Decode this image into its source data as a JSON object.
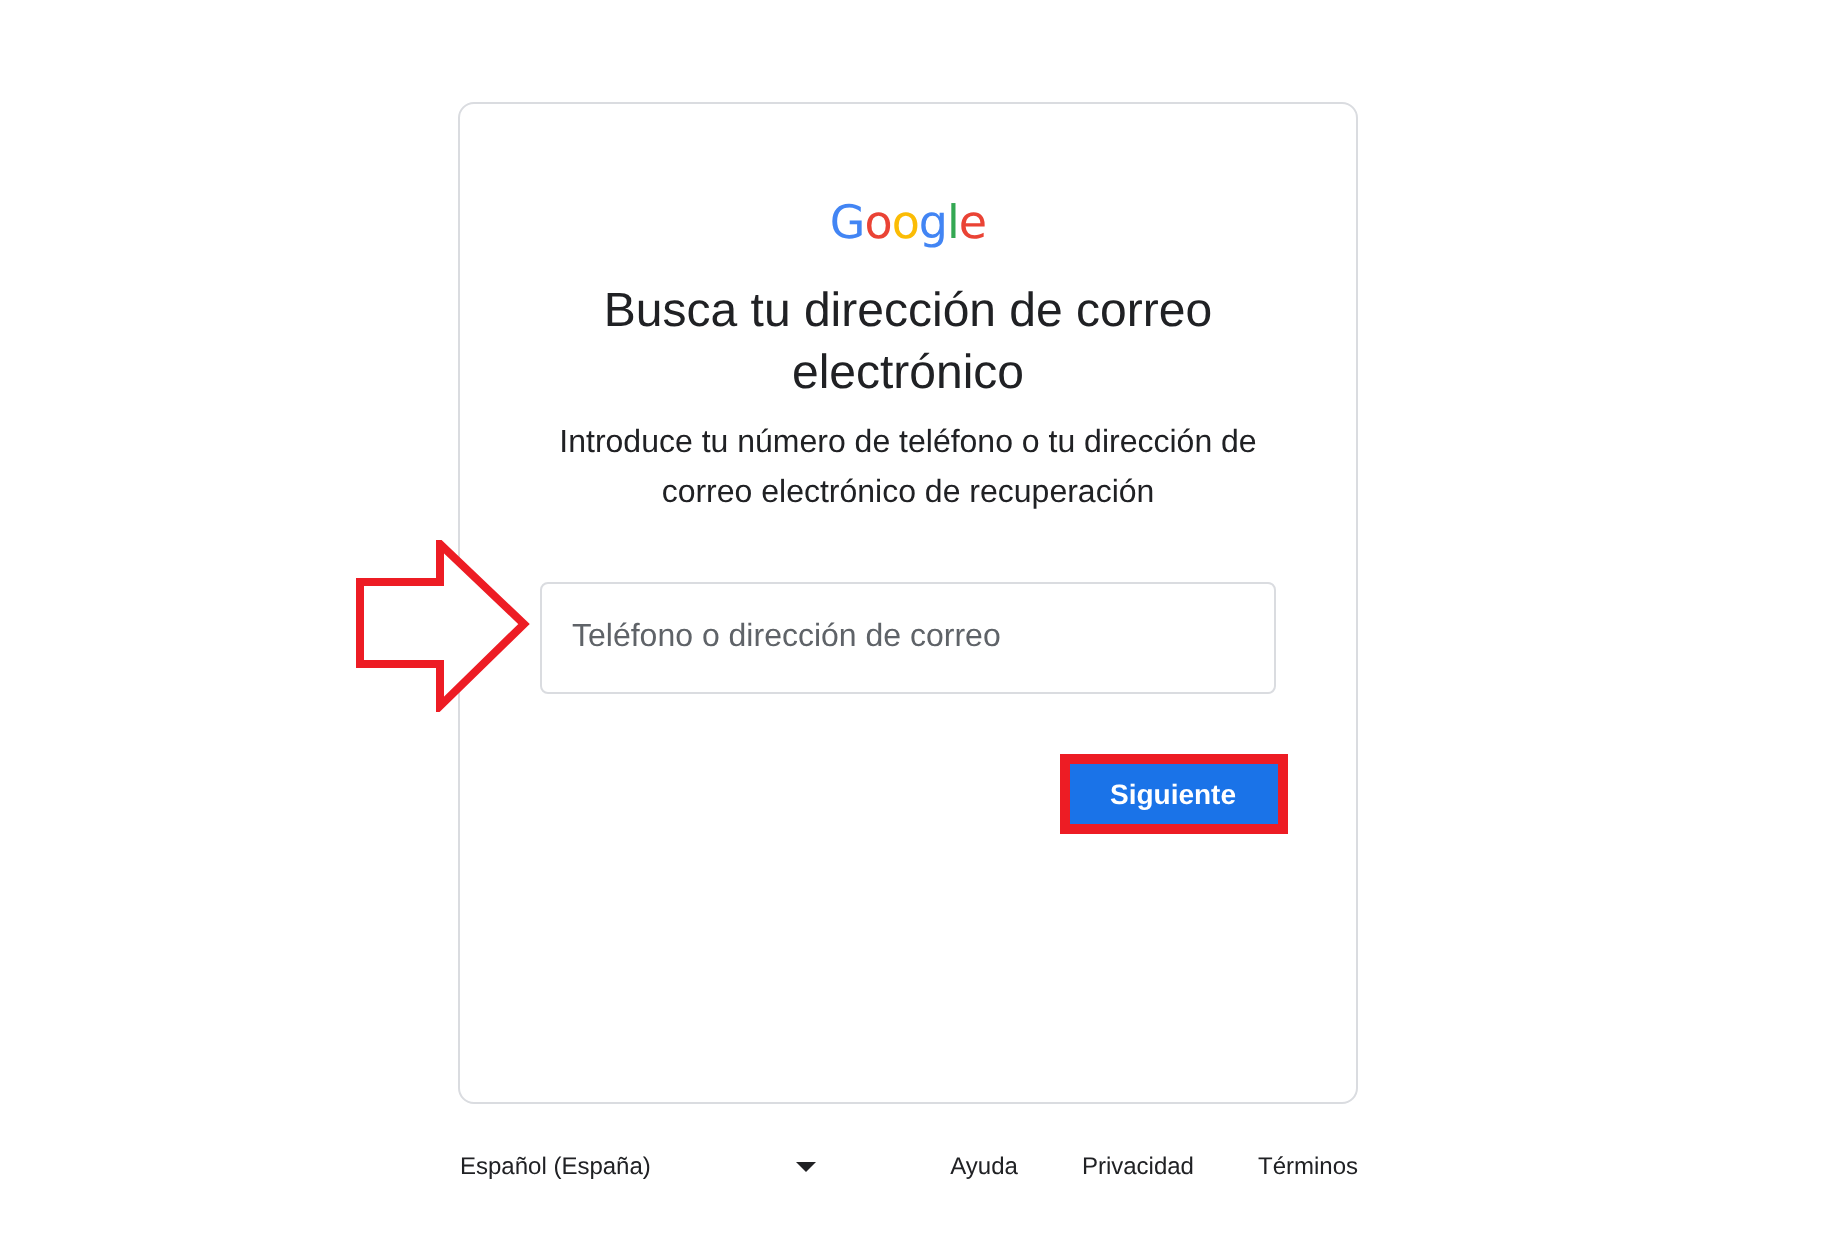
{
  "logo": {
    "text": "Google"
  },
  "heading": "Busca tu dirección de correo electrónico",
  "subheading": "Introduce tu número de teléfono o tu dirección de correo electrónico de recuperación",
  "input": {
    "placeholder": "Teléfono o dirección de correo",
    "annotated": true
  },
  "next_button": {
    "label": "Siguiente",
    "highlighted": true
  },
  "footer": {
    "language": "Español (España)",
    "links": [
      "Ayuda",
      "Privacidad",
      "Términos"
    ]
  }
}
